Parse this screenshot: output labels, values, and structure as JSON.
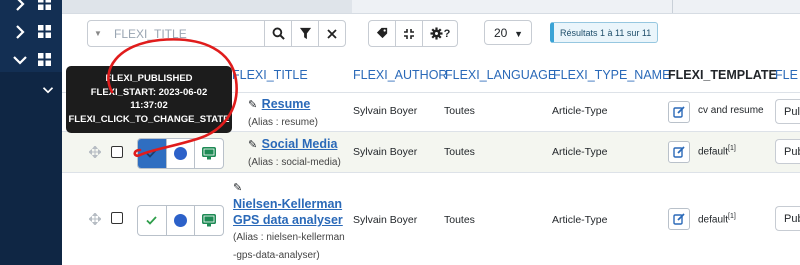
{
  "toolbar": {
    "search_placeholder": "FLEXI_TITLE",
    "limit_value": "20",
    "results_text": "Résultats 1 à 11 sur 11"
  },
  "table": {
    "columns": [
      "FLEXI_TITLE",
      "FLEXI_AUTHOR",
      "FLEXI_LANGUAGE",
      "FLEXI_TYPE_NAME",
      "FLEXI_TEMPLATE",
      "FLE"
    ],
    "rows": [
      {
        "title": "Resume",
        "alias": "(Alias : resume)",
        "author": "Sylvain Boyer",
        "language": "Toutes",
        "type": "Article-Type",
        "template": "cv and resume",
        "template_sup": "",
        "access": "Pul"
      },
      {
        "title": "Social Media",
        "alias": "(Alias : social-media)",
        "author": "Sylvain Boyer",
        "language": "Toutes",
        "type": "Article-Type",
        "template": "default",
        "template_sup": "[1]",
        "access": "Pub"
      },
      {
        "title_line1": "Nielsen-Kellerman",
        "title_line2": "GPS data analyser",
        "alias_line1": "(Alias : nielsen-kellerman",
        "alias_line2": "-gps-data-analyser)",
        "author": "Sylvain Boyer",
        "language": "Toutes",
        "type": "Article-Type",
        "template": "default",
        "template_sup": "[1]",
        "access": "Pub"
      }
    ]
  },
  "tooltip": {
    "line1": "FLEXI_PUBLISHED",
    "line2": "FLEXI_START: 2023-06-02",
    "line3": "11:37:02",
    "line4": "FLEXI_CLICK_TO_CHANGE_STATE"
  },
  "colors": {
    "sidebar": "#132f53",
    "accent_blue": "#2f6ec1",
    "link": "#2a69b8",
    "green_check": "#2e9e4a",
    "annotation_red": "#e01c1c"
  },
  "icons": [
    "chevron-right-icon",
    "grid-icon",
    "chevron-down-icon",
    "search-icon",
    "filter-icon",
    "close-icon",
    "tag-icon",
    "compress-icon",
    "gear-icon",
    "question-icon",
    "drag-handle-icon",
    "check-icon",
    "dot-icon",
    "monitor-icon",
    "edit-icon"
  ]
}
